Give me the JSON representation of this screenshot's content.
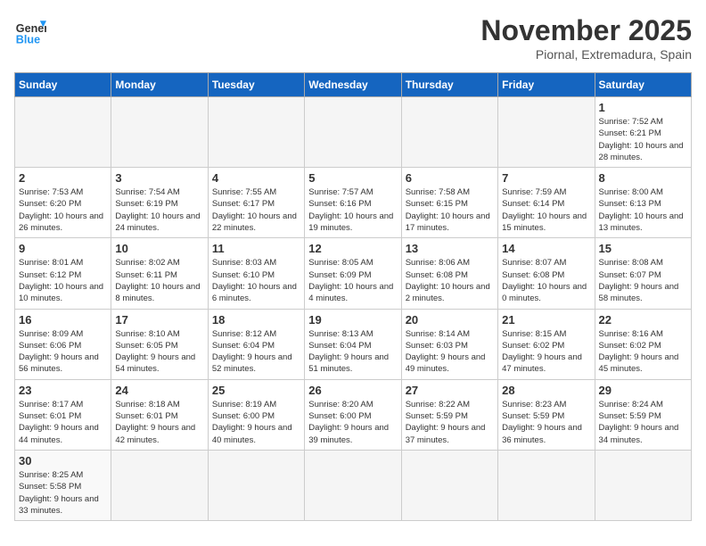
{
  "logo": {
    "text_general": "General",
    "text_blue": "Blue"
  },
  "header": {
    "month": "November 2025",
    "location": "Piornal, Extremadura, Spain"
  },
  "weekdays": [
    "Sunday",
    "Monday",
    "Tuesday",
    "Wednesday",
    "Thursday",
    "Friday",
    "Saturday"
  ],
  "days": [
    {
      "num": "",
      "info": ""
    },
    {
      "num": "",
      "info": ""
    },
    {
      "num": "",
      "info": ""
    },
    {
      "num": "",
      "info": ""
    },
    {
      "num": "",
      "info": ""
    },
    {
      "num": "",
      "info": ""
    },
    {
      "num": "1",
      "info": "Sunrise: 7:52 AM\nSunset: 6:21 PM\nDaylight: 10 hours and 28 minutes."
    },
    {
      "num": "2",
      "info": "Sunrise: 7:53 AM\nSunset: 6:20 PM\nDaylight: 10 hours and 26 minutes."
    },
    {
      "num": "3",
      "info": "Sunrise: 7:54 AM\nSunset: 6:19 PM\nDaylight: 10 hours and 24 minutes."
    },
    {
      "num": "4",
      "info": "Sunrise: 7:55 AM\nSunset: 6:17 PM\nDaylight: 10 hours and 22 minutes."
    },
    {
      "num": "5",
      "info": "Sunrise: 7:57 AM\nSunset: 6:16 PM\nDaylight: 10 hours and 19 minutes."
    },
    {
      "num": "6",
      "info": "Sunrise: 7:58 AM\nSunset: 6:15 PM\nDaylight: 10 hours and 17 minutes."
    },
    {
      "num": "7",
      "info": "Sunrise: 7:59 AM\nSunset: 6:14 PM\nDaylight: 10 hours and 15 minutes."
    },
    {
      "num": "8",
      "info": "Sunrise: 8:00 AM\nSunset: 6:13 PM\nDaylight: 10 hours and 13 minutes."
    },
    {
      "num": "9",
      "info": "Sunrise: 8:01 AM\nSunset: 6:12 PM\nDaylight: 10 hours and 10 minutes."
    },
    {
      "num": "10",
      "info": "Sunrise: 8:02 AM\nSunset: 6:11 PM\nDaylight: 10 hours and 8 minutes."
    },
    {
      "num": "11",
      "info": "Sunrise: 8:03 AM\nSunset: 6:10 PM\nDaylight: 10 hours and 6 minutes."
    },
    {
      "num": "12",
      "info": "Sunrise: 8:05 AM\nSunset: 6:09 PM\nDaylight: 10 hours and 4 minutes."
    },
    {
      "num": "13",
      "info": "Sunrise: 8:06 AM\nSunset: 6:08 PM\nDaylight: 10 hours and 2 minutes."
    },
    {
      "num": "14",
      "info": "Sunrise: 8:07 AM\nSunset: 6:08 PM\nDaylight: 10 hours and 0 minutes."
    },
    {
      "num": "15",
      "info": "Sunrise: 8:08 AM\nSunset: 6:07 PM\nDaylight: 9 hours and 58 minutes."
    },
    {
      "num": "16",
      "info": "Sunrise: 8:09 AM\nSunset: 6:06 PM\nDaylight: 9 hours and 56 minutes."
    },
    {
      "num": "17",
      "info": "Sunrise: 8:10 AM\nSunset: 6:05 PM\nDaylight: 9 hours and 54 minutes."
    },
    {
      "num": "18",
      "info": "Sunrise: 8:12 AM\nSunset: 6:04 PM\nDaylight: 9 hours and 52 minutes."
    },
    {
      "num": "19",
      "info": "Sunrise: 8:13 AM\nSunset: 6:04 PM\nDaylight: 9 hours and 51 minutes."
    },
    {
      "num": "20",
      "info": "Sunrise: 8:14 AM\nSunset: 6:03 PM\nDaylight: 9 hours and 49 minutes."
    },
    {
      "num": "21",
      "info": "Sunrise: 8:15 AM\nSunset: 6:02 PM\nDaylight: 9 hours and 47 minutes."
    },
    {
      "num": "22",
      "info": "Sunrise: 8:16 AM\nSunset: 6:02 PM\nDaylight: 9 hours and 45 minutes."
    },
    {
      "num": "23",
      "info": "Sunrise: 8:17 AM\nSunset: 6:01 PM\nDaylight: 9 hours and 44 minutes."
    },
    {
      "num": "24",
      "info": "Sunrise: 8:18 AM\nSunset: 6:01 PM\nDaylight: 9 hours and 42 minutes."
    },
    {
      "num": "25",
      "info": "Sunrise: 8:19 AM\nSunset: 6:00 PM\nDaylight: 9 hours and 40 minutes."
    },
    {
      "num": "26",
      "info": "Sunrise: 8:20 AM\nSunset: 6:00 PM\nDaylight: 9 hours and 39 minutes."
    },
    {
      "num": "27",
      "info": "Sunrise: 8:22 AM\nSunset: 5:59 PM\nDaylight: 9 hours and 37 minutes."
    },
    {
      "num": "28",
      "info": "Sunrise: 8:23 AM\nSunset: 5:59 PM\nDaylight: 9 hours and 36 minutes."
    },
    {
      "num": "29",
      "info": "Sunrise: 8:24 AM\nSunset: 5:59 PM\nDaylight: 9 hours and 34 minutes."
    },
    {
      "num": "30",
      "info": "Sunrise: 8:25 AM\nSunset: 5:58 PM\nDaylight: 9 hours and 33 minutes."
    }
  ]
}
